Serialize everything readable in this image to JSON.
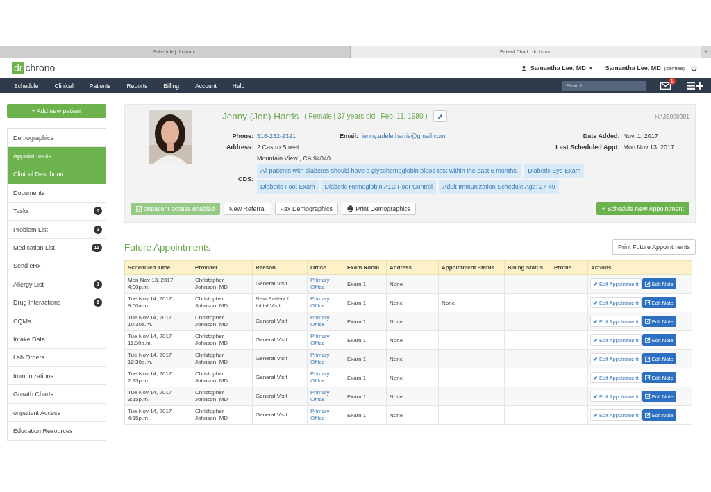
{
  "browser_tabs": [
    {
      "title": "Schedule | drchrono",
      "selected": false
    },
    {
      "title": "Patient Chart | drchrono",
      "selected": true
    }
  ],
  "new_tab_button": "+",
  "logo": {
    "mark": "dr",
    "text": "chrono"
  },
  "user_menu": {
    "name": "Samantha Lee, MD",
    "caret": "▾"
  },
  "account": {
    "name": "Samantha Lee, MD",
    "username": "(samlee)"
  },
  "nav": {
    "items": [
      "Schedule",
      "Clinical",
      "Patients",
      "Reports",
      "Billing",
      "Account",
      "Help"
    ],
    "search": {
      "placeholder": "Search"
    },
    "mail_badge": "1"
  },
  "add_patient_button": "+ Add new patient",
  "sidebar": {
    "items": [
      {
        "label": "Demographics",
        "selected": false
      },
      {
        "label": "Appointments",
        "selected": true
      },
      {
        "label": "Clinical Dashboard",
        "selected": true
      },
      {
        "label": "Documents",
        "selected": false
      },
      {
        "label": "Tasks",
        "selected": false,
        "badge": "0"
      },
      {
        "label": "Problem List",
        "selected": false,
        "badge": "2"
      },
      {
        "label": "Medication List",
        "selected": false,
        "badge": "11"
      },
      {
        "label": "Send eRx",
        "selected": false
      },
      {
        "label": "Allergy List",
        "selected": false,
        "badge": "2"
      },
      {
        "label": "Drug Interactions",
        "selected": false,
        "badge": "6"
      },
      {
        "label": "CQMs",
        "selected": false
      },
      {
        "label": "Intake Data",
        "selected": false
      },
      {
        "label": "Lab Orders",
        "selected": false
      },
      {
        "label": "Immunizations",
        "selected": false
      },
      {
        "label": "Growth Charts",
        "selected": false
      },
      {
        "label": "onpatient Access",
        "selected": false
      },
      {
        "label": "Education Resources",
        "selected": false
      }
    ]
  },
  "patient": {
    "name": "Jenny (Jen) Harris",
    "summary": "( Female | 37 years old | Feb. 11, 1980 )",
    "id": "HAJE000001",
    "phone_label": "Phone:",
    "phone": "516-232-2321",
    "email_label": "Email:",
    "email": "jenny.adele.harris@gmail.com",
    "address_label": "Address:",
    "address_lines": [
      "2 Castro Street",
      "Mountain View , CA 94040"
    ],
    "date_added_label": "Date Added:",
    "date_added": "Nov. 1, 2017",
    "last_appt_label": "Last Scheduled Appt:",
    "last_appt": "Mon Nov 13, 2017",
    "cds_label": "CDS:",
    "cds": [
      "All patients with diabetes should have a glycohemoglobin blood test within the past 6 months.",
      "Diabetic Eye Exam",
      "Diabetic Foot Exam",
      "Diabetic Hemoglobin A1C Poor Control",
      "Adult Immunization Schedule Age: 27-49"
    ],
    "buttons": [
      {
        "label": "onpatient access enabled",
        "kind": "status"
      },
      {
        "label": "New Referral",
        "kind": "plain"
      },
      {
        "label": "Fax Demographics",
        "kind": "plain"
      },
      {
        "label": "Print Demographics",
        "kind": "print"
      }
    ],
    "schedule_button": "+ Schedule New Appointment"
  },
  "appointments": {
    "title": "Future Appointments",
    "print_button": "Print Future Appointments",
    "columns": [
      "Scheduled Time",
      "Provider",
      "Reason",
      "Office",
      "Exam Room",
      "Address",
      "Appointment Status",
      "Billing Status",
      "Profile",
      "Actions"
    ],
    "rows": [
      {
        "time": [
          "Mon Nov 13, 2017",
          "4:30p.m."
        ],
        "provider": [
          "Christopher",
          "Johnson, MD"
        ],
        "reason": [
          "General Visit"
        ],
        "office": [
          "Primary",
          "Office"
        ],
        "room": "Exam 1",
        "address": "None",
        "status": "",
        "actions": [
          "Edit Appointment",
          "Edit Note"
        ]
      },
      {
        "time": [
          "Tue Nov 14, 2017",
          "9:00a.m."
        ],
        "provider": [
          "Christopher",
          "Johnson, MD"
        ],
        "reason": [
          "New Patient /",
          "Initial Visit"
        ],
        "office": [
          "Primary",
          "Office"
        ],
        "room": "Exam 1",
        "address": "None",
        "status": "None",
        "actions": [
          "Edit Appointment",
          "Edit Note"
        ]
      },
      {
        "time": [
          "Tue Nov 14, 2017",
          "10:30a.m."
        ],
        "provider": [
          "Christopher",
          "Johnson, MD"
        ],
        "reason": [
          "General Visit"
        ],
        "office": [
          "Primary",
          "Office"
        ],
        "room": "Exam 1",
        "address": "None",
        "status": "",
        "actions": [
          "Edit Appointment",
          "Edit Note"
        ]
      },
      {
        "time": [
          "Tue Nov 14, 2017",
          "11:30a.m."
        ],
        "provider": [
          "Christopher",
          "Johnson, MD"
        ],
        "reason": [
          "General Visit"
        ],
        "office": [
          "Primary",
          "Office"
        ],
        "room": "Exam 1",
        "address": "None",
        "status": "",
        "actions": [
          "Edit Appointment",
          "Edit Note"
        ]
      },
      {
        "time": [
          "Tue Nov 14, 2017",
          "12:30p.m."
        ],
        "provider": [
          "Christopher",
          "Johnson, MD"
        ],
        "reason": [
          "General Visit"
        ],
        "office": [
          "Primary",
          "Office"
        ],
        "room": "Exam 1",
        "address": "None",
        "status": "",
        "actions": [
          "Edit Appointment",
          "Edit Note"
        ]
      },
      {
        "time": [
          "Tue Nov 14, 2017",
          "2:15p.m."
        ],
        "provider": [
          "Christopher",
          "Johnson, MD"
        ],
        "reason": [
          "General Visit"
        ],
        "office": [
          "Primary",
          "Office"
        ],
        "room": "Exam 1",
        "address": "None",
        "status": "",
        "actions": [
          "Edit Appointment",
          "Edit Note"
        ]
      },
      {
        "time": [
          "Tue Nov 14, 2017",
          "3:15p.m."
        ],
        "provider": [
          "Christopher",
          "Johnson, MD"
        ],
        "reason": [
          "General Visit"
        ],
        "office": [
          "Primary",
          "Office"
        ],
        "room": "Exam 1",
        "address": "None",
        "status": "",
        "actions": [
          "Edit Appointment",
          "Edit Note"
        ]
      },
      {
        "time": [
          "Tue Nov 14, 2017",
          "4:15p.m."
        ],
        "provider": [
          "Christopher",
          "Johnson, MD"
        ],
        "reason": [
          "General Visit"
        ],
        "office": [
          "Primary",
          "Office"
        ],
        "room": "Exam 1",
        "address": "None",
        "status": "",
        "actions": [
          "Edit Appointment",
          "Edit Note"
        ]
      }
    ]
  }
}
